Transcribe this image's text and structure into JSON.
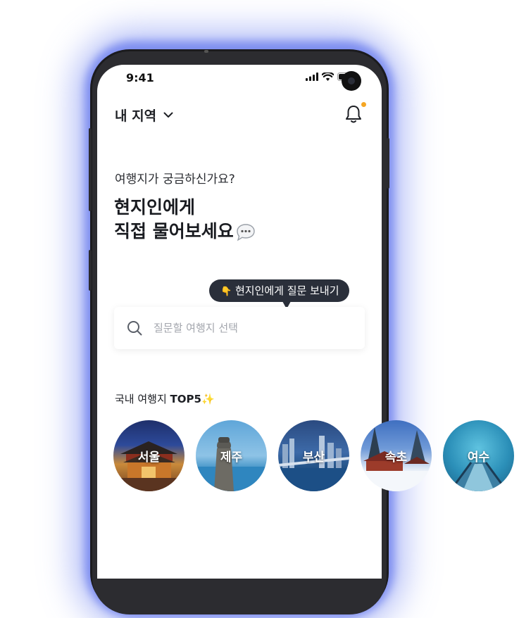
{
  "status_bar": {
    "time": "9:41"
  },
  "header": {
    "region_label": "내 지역"
  },
  "intro": {
    "subtitle": "여행지가 궁금하신가요?",
    "headline_line1": "현지인에게",
    "headline_line2": "직접 물어보세요"
  },
  "tooltip": {
    "emoji": "👇",
    "text": "현지인에게 질문 보내기"
  },
  "search": {
    "placeholder": "질문할 여행지 선택",
    "value": ""
  },
  "top5": {
    "title_prefix": "국내 여행지 ",
    "title_bold": "TOP5",
    "sparkle": "✨",
    "cities": [
      {
        "name": "서울"
      },
      {
        "name": "제주"
      },
      {
        "name": "부산"
      },
      {
        "name": "속초"
      },
      {
        "name": "여수"
      }
    ]
  },
  "colors": {
    "accent_dot": "#f5a623",
    "tooltip_bg": "#2a2f3a",
    "phone_glow": "#7f8ff0"
  },
  "icons": [
    "chevron-down-icon",
    "bell-icon",
    "speech-bubble-icon",
    "search-icon",
    "signal-icon",
    "wifi-icon",
    "battery-icon"
  ]
}
